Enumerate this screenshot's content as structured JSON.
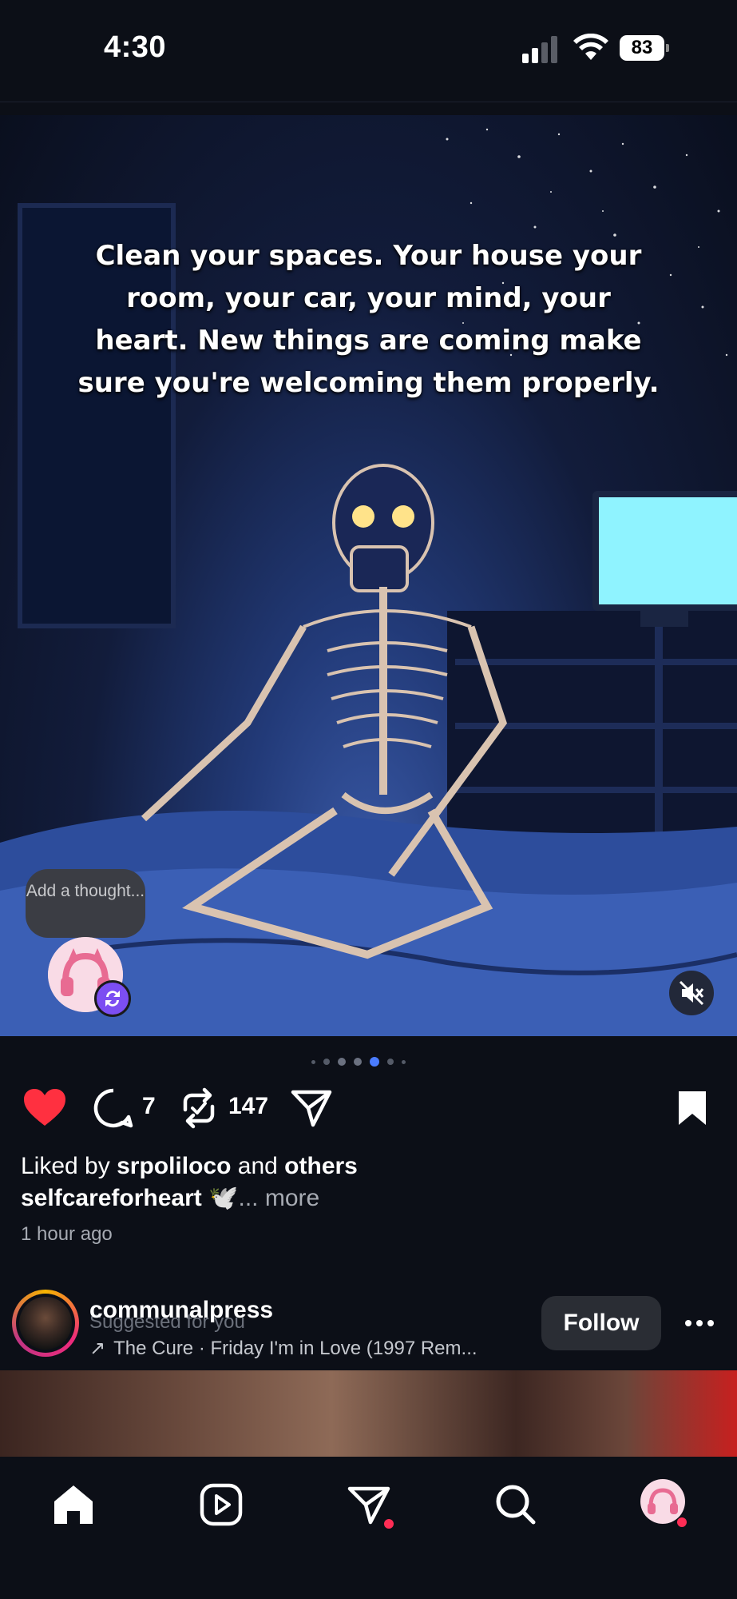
{
  "status_bar": {
    "time": "4:30",
    "battery": "83"
  },
  "post": {
    "image_caption": "Clean your spaces. Your house your room, your car, your mind, your heart. New things are coming make sure you're welcoming them properly.",
    "thought_placeholder": "Add a thought...",
    "comment_count": "7",
    "repost_count": "147",
    "liked_by_prefix": "Liked by ",
    "liked_by_user": "srpoliloco",
    "liked_by_mid": " and ",
    "liked_by_others": "others",
    "author": "selfcareforheart",
    "caption_emoji": "🕊️",
    "more_label": "... more",
    "time_ago": "1 hour ago",
    "carousel_active_index": 3
  },
  "suggested": {
    "username": "communalpress",
    "subtitle": "Suggested for you",
    "music": "The Cure · Friday I'm in Love (1997 Rem...",
    "follow_label": "Follow"
  },
  "colors": {
    "like": "#ff3040",
    "accent": "#4a7cff",
    "badge": "#7c4ef2",
    "notify": "#ff2d55"
  },
  "nav": {
    "items": [
      "home-icon",
      "reels-icon",
      "messages-icon",
      "search-icon",
      "profile-avatar"
    ]
  }
}
